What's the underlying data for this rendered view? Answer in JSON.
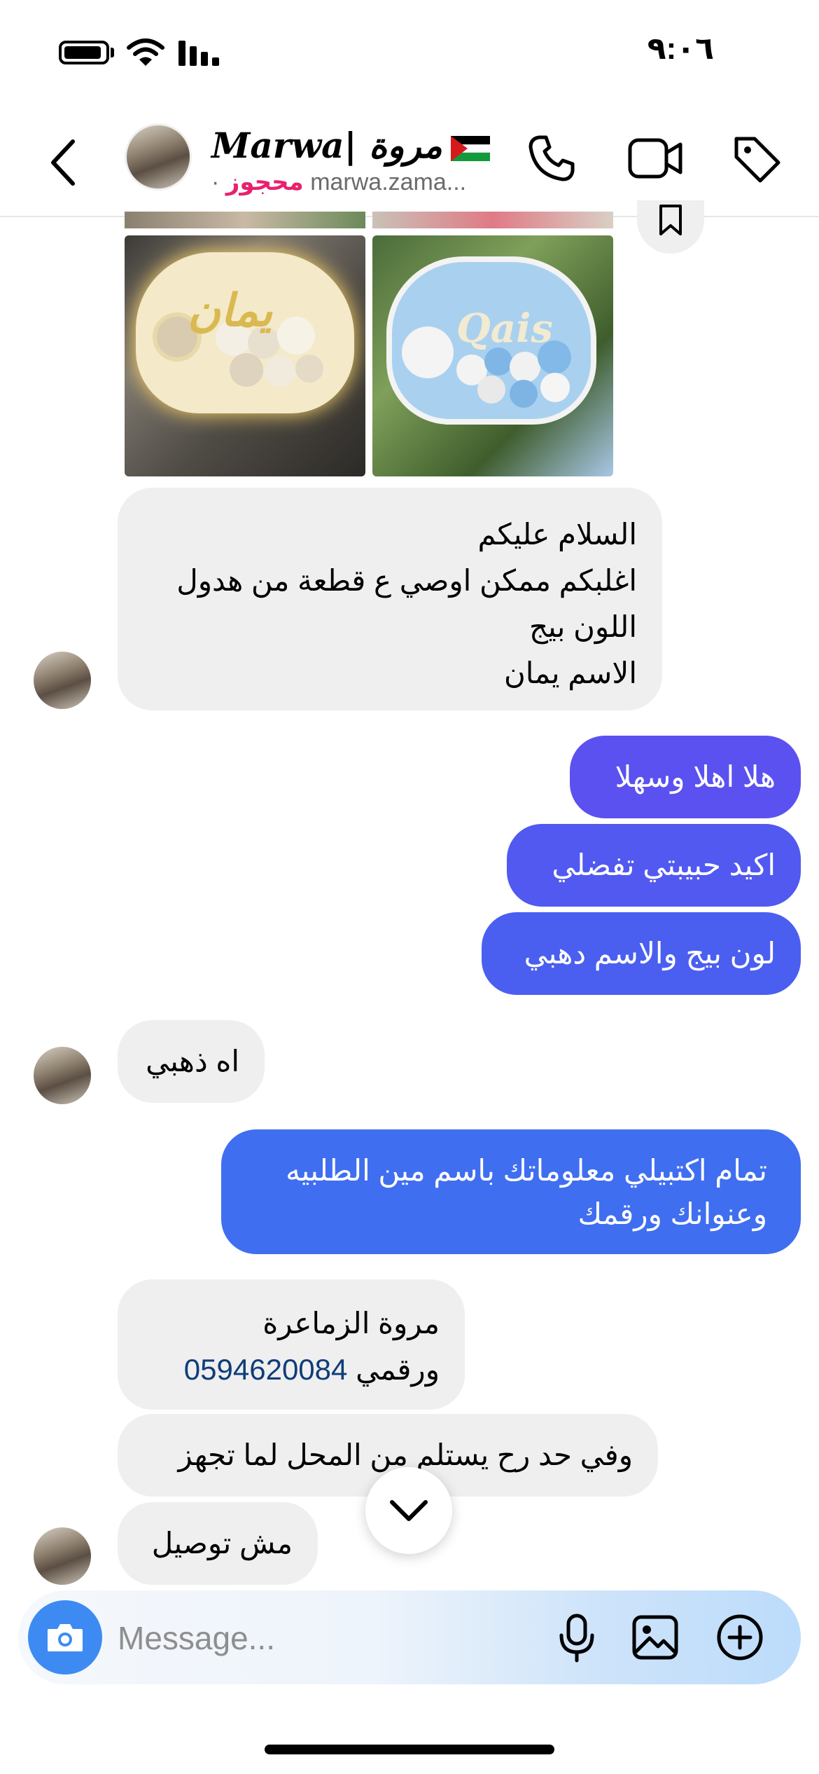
{
  "status": {
    "time": "٩:٠٦"
  },
  "header": {
    "name": "Marwa| مروة",
    "flag_icon": "palestine-flag-icon",
    "status_word": "محجوز",
    "separator": "·",
    "username": "marwa.zama..."
  },
  "messages": [
    {
      "side": "in",
      "lines": [
        "السلام عليكم",
        "اغلبكم ممكن اوصي ع قطعة من هدول",
        "اللون بيج",
        "الاسم يمان"
      ]
    },
    {
      "side": "out",
      "lines": [
        "هلا اهلا وسهلا"
      ]
    },
    {
      "side": "out",
      "lines": [
        "اكيد حبيبتي تفضلي"
      ]
    },
    {
      "side": "out",
      "lines": [
        "لون بيج والاسم دهبي"
      ]
    },
    {
      "side": "in",
      "lines": [
        "اه ذهبي"
      ]
    },
    {
      "side": "out",
      "lines": [
        "تمام اكتبيلي معلوماتك باسم مين الطلبيه",
        "وعنوانك ورقمك"
      ]
    },
    {
      "side": "in",
      "lines": [
        "مروة الزماعرة"
      ],
      "prefix": "ورقمي",
      "phone": "0594620084"
    },
    {
      "side": "in",
      "lines": [
        "وفي حد رح يستلم من المحل لما تجهز"
      ]
    },
    {
      "side": "in",
      "lines": [
        "مش توصيل"
      ]
    }
  ],
  "images": {
    "photo2_text": "Qais"
  },
  "composer": {
    "placeholder": "Message..."
  },
  "colors": {
    "outgoing_top": "#5b51f0",
    "outgoing_bottom": "#3d6ff0",
    "camera": "#3d8bf2",
    "pink": "#e8216e",
    "incoming": "#efefef"
  }
}
